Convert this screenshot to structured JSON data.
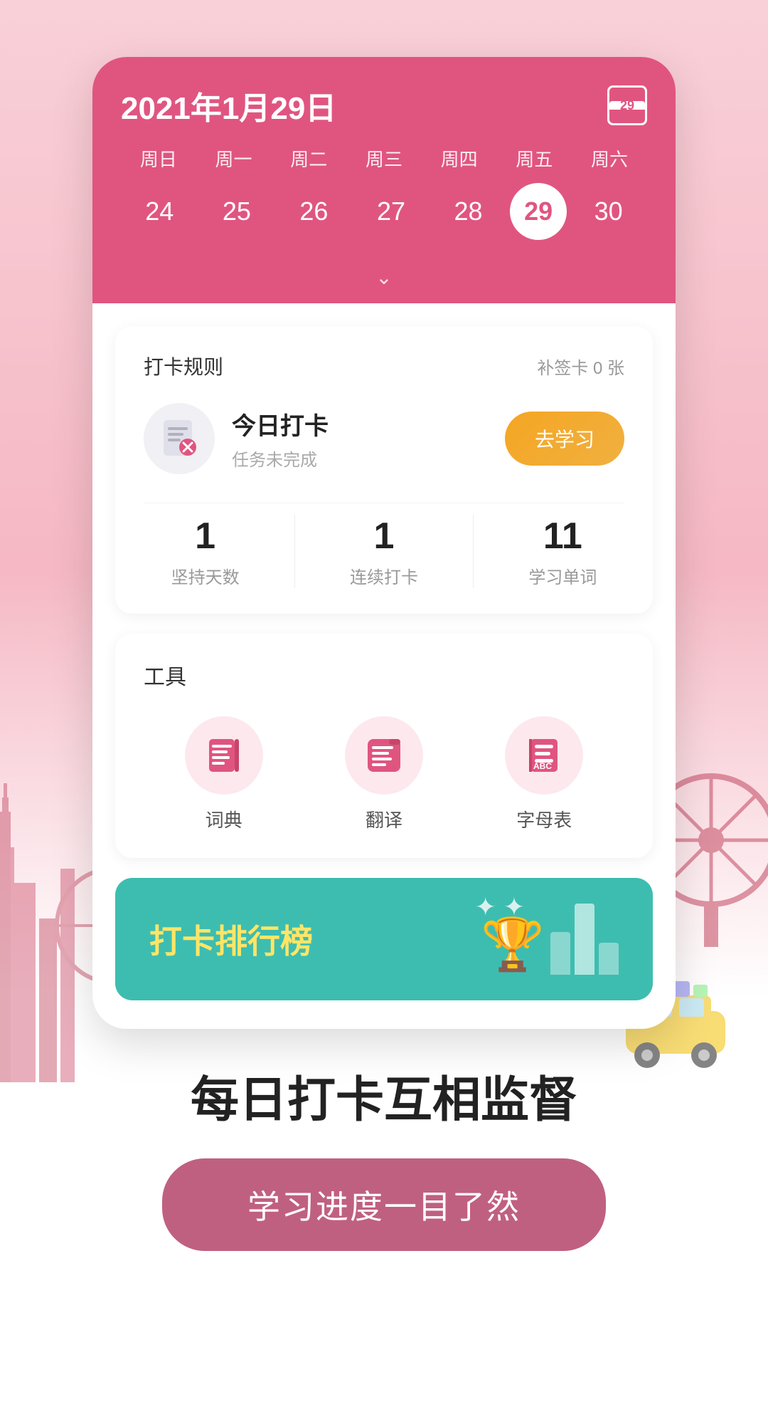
{
  "background": {
    "color": "#f9d0d8"
  },
  "calendar": {
    "title": "2021年1月29日",
    "icon_num": "29",
    "week_days": [
      "周日",
      "周一",
      "周二",
      "周三",
      "周四",
      "周五",
      "周六"
    ],
    "dates": [
      {
        "num": "24",
        "active": false
      },
      {
        "num": "25",
        "active": false
      },
      {
        "num": "26",
        "active": false
      },
      {
        "num": "27",
        "active": false
      },
      {
        "num": "28",
        "active": false
      },
      {
        "num": "29",
        "active": true
      },
      {
        "num": "30",
        "active": false
      }
    ],
    "chevron": "∨"
  },
  "checkin_card": {
    "rule_label": "打卡规则",
    "supplement_label": "补签卡 0 张",
    "today_label": "今日打卡",
    "today_sub": "任务未完成",
    "go_study_btn": "去学习",
    "stats": [
      {
        "num": "1",
        "label": "坚持天数"
      },
      {
        "num": "1",
        "label": "连续打卡"
      },
      {
        "num": "11",
        "label": "学习单词"
      }
    ]
  },
  "tools": {
    "title": "工具",
    "items": [
      {
        "label": "词典",
        "icon": "dictionary"
      },
      {
        "label": "翻译",
        "icon": "translate"
      },
      {
        "label": "字母表",
        "icon": "alphabet"
      }
    ]
  },
  "ranking": {
    "text_pre": "打卡",
    "text_highlight": "排行榜",
    "sparkles": "✦ ✦"
  },
  "bottom": {
    "headline": "每日打卡互相监督",
    "button_label": "学习进度一目了然"
  }
}
